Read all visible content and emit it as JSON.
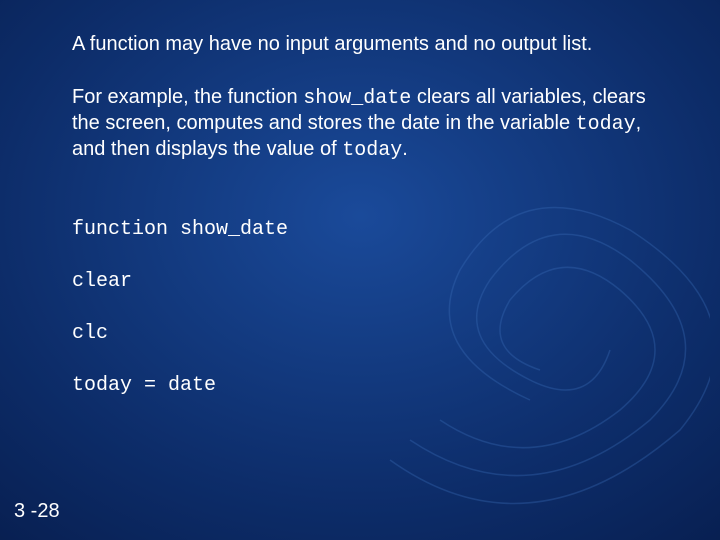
{
  "para1": "A function may have no input arguments and no output list.",
  "para2": {
    "t1": "For example, the function ",
    "c1": "show_date",
    "t2": " clears all variables, clears the screen, computes and stores the date in the variable ",
    "c2": "today",
    "t3": ", and then displays the value of ",
    "c3": "today",
    "t4": "."
  },
  "code": {
    "l1": "function show_date",
    "l2": "clear",
    "l3": "clc",
    "l4": "today = date"
  },
  "page_number": "3 -28"
}
